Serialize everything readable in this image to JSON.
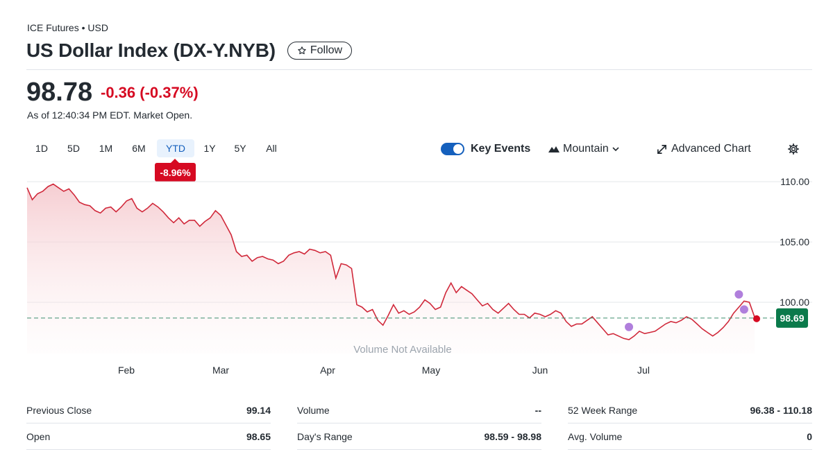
{
  "header": {
    "exchange": "ICE Futures • USD",
    "title": "US Dollar Index (DX-Y.NYB)",
    "follow_label": "Follow"
  },
  "quote": {
    "price": "98.78",
    "change": "-0.36",
    "change_pct": "(-0.37%)",
    "as_of": "As of 12:40:34 PM EDT. Market Open."
  },
  "ranges": [
    "1D",
    "5D",
    "1M",
    "6M",
    "YTD",
    "1Y",
    "5Y",
    "All"
  ],
  "active_range": "YTD",
  "range_badge": "-8.96%",
  "controls": {
    "key_events_label": "Key Events",
    "key_events_on": true,
    "chart_type_label": "Mountain",
    "advanced_label": "Advanced Chart"
  },
  "colors": {
    "line": "#d0283a",
    "fill": "#f7d2d6",
    "negative": "#d60a22",
    "current_tag": "#0b7a4b",
    "event_dot": "#b07fdc",
    "accent": "#1560bd"
  },
  "chart_data": {
    "type": "area",
    "volume_note": "Volume Not Available",
    "x_month_labels": [
      "Feb",
      "Mar",
      "Apr",
      "May",
      "Jun",
      "Jul"
    ],
    "y_ticks": [
      "110.00",
      "105.00",
      "100.00"
    ],
    "ylim": [
      96.0,
      110.8
    ],
    "previous_close": 98.69,
    "current_tag": "98.69",
    "grid": true,
    "values": [
      109.5,
      108.5,
      109.0,
      109.2,
      109.6,
      109.8,
      109.5,
      109.2,
      109.4,
      108.9,
      108.3,
      108.1,
      108.0,
      107.6,
      107.4,
      107.8,
      107.9,
      107.5,
      107.9,
      108.4,
      108.6,
      107.8,
      107.5,
      107.8,
      108.2,
      107.9,
      107.5,
      107.0,
      106.6,
      107.0,
      106.5,
      106.8,
      106.8,
      106.3,
      106.7,
      107.0,
      107.6,
      107.2,
      106.4,
      105.6,
      104.2,
      103.8,
      103.9,
      103.4,
      103.7,
      103.8,
      103.6,
      103.5,
      103.2,
      103.4,
      103.9,
      104.1,
      104.2,
      104.0,
      104.4,
      104.3,
      104.1,
      104.2,
      103.9,
      102.0,
      103.2,
      103.1,
      102.8,
      99.8,
      99.6,
      99.2,
      99.4,
      98.5,
      98.1,
      98.9,
      99.8,
      99.1,
      99.3,
      99.0,
      99.2,
      99.6,
      100.2,
      99.9,
      99.4,
      99.6,
      100.8,
      101.6,
      100.8,
      101.3,
      101.0,
      100.7,
      100.2,
      99.7,
      99.9,
      99.4,
      99.1,
      99.5,
      99.9,
      99.4,
      99.0,
      99.0,
      98.7,
      99.1,
      99.0,
      98.8,
      99.0,
      99.3,
      99.1,
      98.4,
      98.0,
      98.2,
      98.2,
      98.5,
      98.8,
      98.3,
      97.8,
      97.3,
      97.4,
      97.2,
      97.0,
      96.9,
      97.2,
      97.6,
      97.4,
      97.5,
      97.6,
      97.9,
      98.2,
      98.4,
      98.3,
      98.5,
      98.8,
      98.6,
      98.2,
      97.8,
      97.5,
      97.2,
      97.5,
      97.9,
      98.4,
      99.1,
      99.6,
      100.1,
      100.0,
      98.78
    ],
    "event_markers": [
      {
        "index": 115,
        "value": 97.95
      },
      {
        "index": 136,
        "value": 100.65
      },
      {
        "index": 137,
        "value": 99.4
      }
    ]
  },
  "stats": [
    {
      "label": "Previous Close",
      "value": "99.14"
    },
    {
      "label": "Volume",
      "value": "--"
    },
    {
      "label": "52 Week Range",
      "value": "96.38 - 110.18"
    },
    {
      "label": "Open",
      "value": "98.65"
    },
    {
      "label": "Day's Range",
      "value": "98.59 - 98.98"
    },
    {
      "label": "Avg. Volume",
      "value": "0"
    }
  ]
}
